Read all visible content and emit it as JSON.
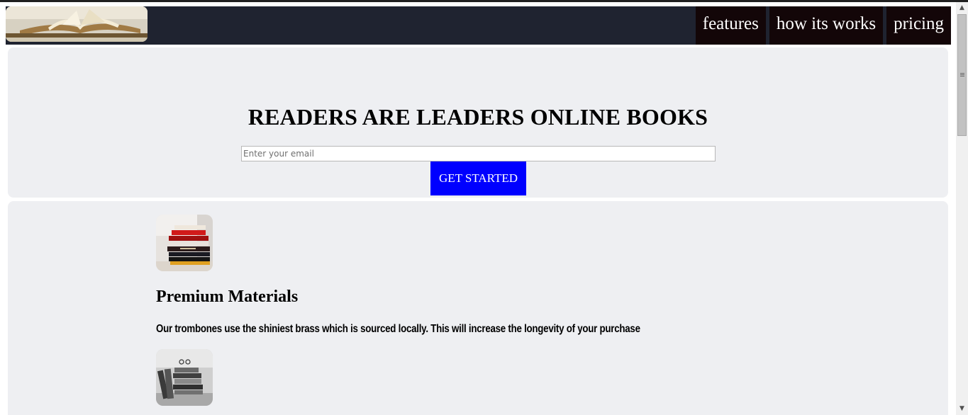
{
  "header": {
    "logo_alt": "open book logo",
    "nav": [
      {
        "label": "features"
      },
      {
        "label": "how its works"
      },
      {
        "label": "pricing"
      }
    ]
  },
  "hero": {
    "title": "READERS ARE LEADERS ONLINE BOOKS",
    "email_placeholder": "Enter your email",
    "email_value": "",
    "cta_label": "GET STARTED"
  },
  "features": [
    {
      "image": "stacked-books-image",
      "title": "Premium Materials",
      "description": "Our trombones use the shiniest brass which is sourced locally. This will increase the longevity of your purchase"
    },
    {
      "image": "bw-books-image"
    }
  ],
  "colors": {
    "header_bg": "#1f2330",
    "nav_bg": "#130608",
    "section_bg": "#eeeff2",
    "cta_bg": "#0000ff"
  }
}
